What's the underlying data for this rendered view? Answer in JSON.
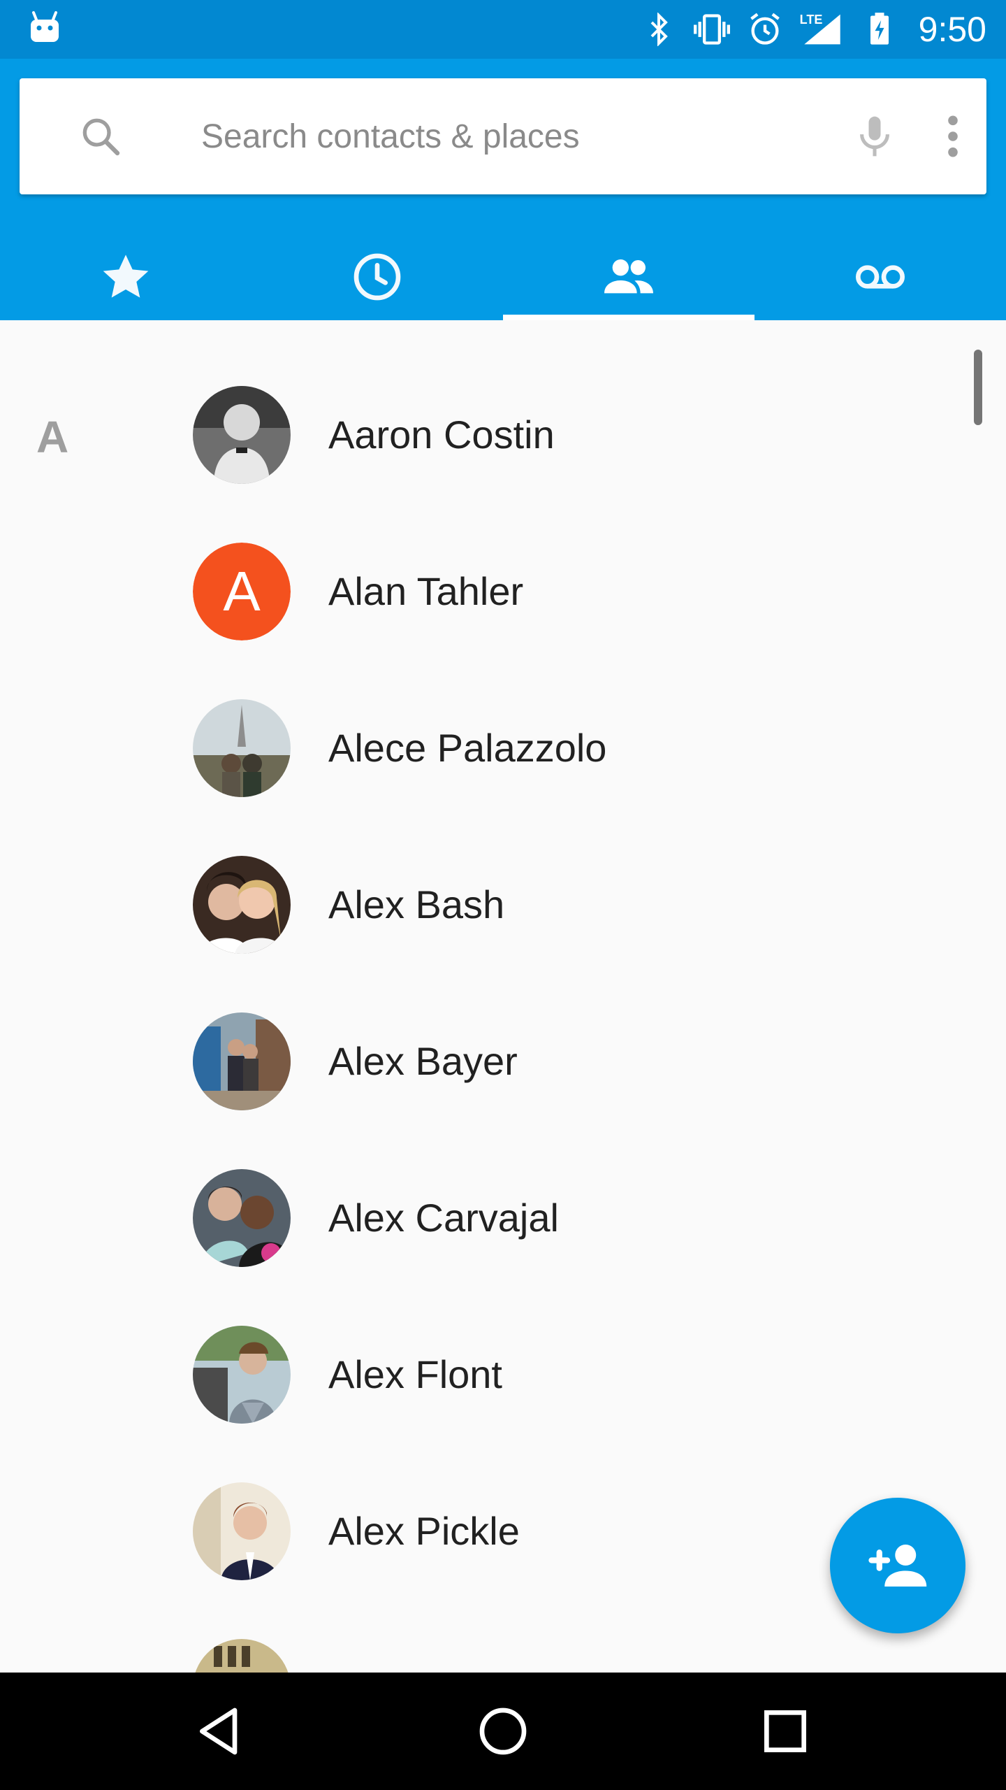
{
  "status_bar": {
    "time": "9:50",
    "icons": [
      "android-debug-icon",
      "bluetooth-icon",
      "vibrate-icon",
      "alarm-icon",
      "lte-signal-icon",
      "battery-charging-icon"
    ],
    "network_label": "LTE"
  },
  "search": {
    "placeholder": "Search contacts & places",
    "value": ""
  },
  "tabs": [
    {
      "name": "speed-dial",
      "icon": "star-icon",
      "selected": false
    },
    {
      "name": "recents",
      "icon": "clock-icon",
      "selected": false
    },
    {
      "name": "contacts",
      "icon": "people-icon",
      "selected": true
    },
    {
      "name": "voicemail",
      "icon": "voicemail-icon",
      "selected": false
    }
  ],
  "contacts": {
    "section_letter": "A",
    "items": [
      {
        "name": "Aaron Costin",
        "avatar": "photo"
      },
      {
        "name": "Alan Tahler",
        "avatar": "letter",
        "letter": "A",
        "color": "#f4511e"
      },
      {
        "name": "Alece Palazzolo",
        "avatar": "photo"
      },
      {
        "name": "Alex Bash",
        "avatar": "photo"
      },
      {
        "name": "Alex Bayer",
        "avatar": "photo"
      },
      {
        "name": "Alex Carvajal",
        "avatar": "photo"
      },
      {
        "name": "Alex Flont",
        "avatar": "photo"
      },
      {
        "name": "Alex Pickle",
        "avatar": "photo"
      }
    ]
  },
  "fab": {
    "icon": "add-contact-icon"
  },
  "colors": {
    "status_bar": "#0288d1",
    "app_bar": "#039be5",
    "accent": "#039be5",
    "letter_avatar": "#f4511e"
  }
}
